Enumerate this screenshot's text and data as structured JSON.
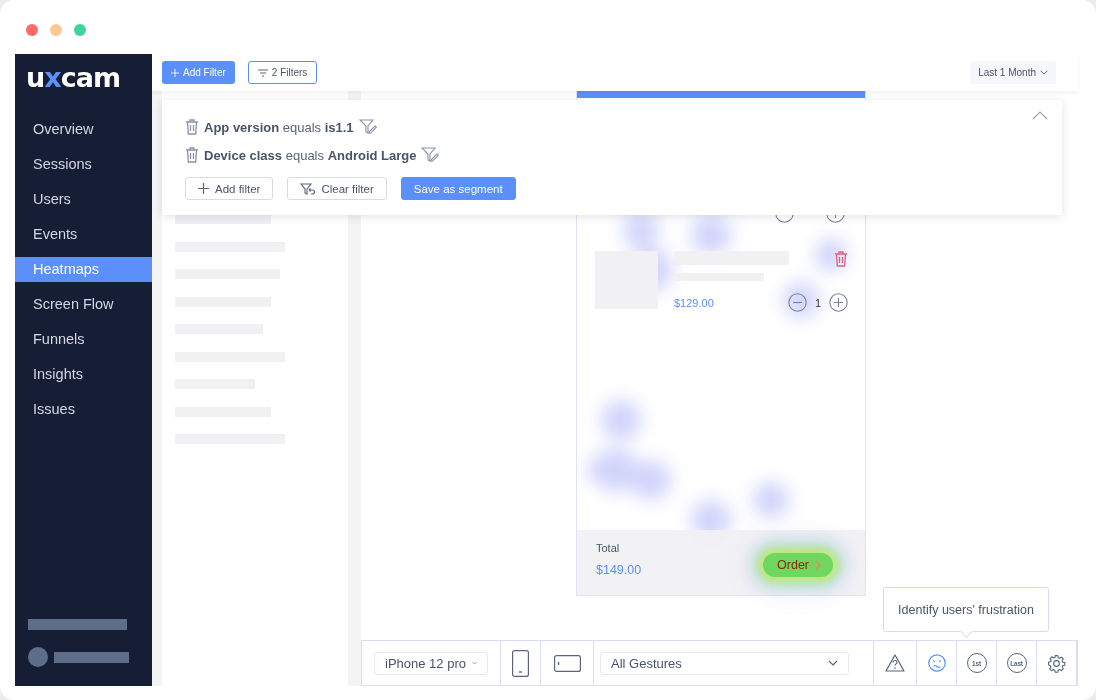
{
  "sidebar": {
    "logo": "uxcam",
    "items": [
      {
        "label": "Overview",
        "selected": false
      },
      {
        "label": "Sessions",
        "selected": false
      },
      {
        "label": "Users",
        "selected": false
      },
      {
        "label": "Events",
        "selected": false
      },
      {
        "label": "Heatmaps",
        "selected": true
      },
      {
        "label": "Screen Flow",
        "selected": false
      },
      {
        "label": "Funnels",
        "selected": false
      },
      {
        "label": "Insights",
        "selected": false
      },
      {
        "label": "Issues",
        "selected": false
      }
    ]
  },
  "topbar": {
    "add_filter": "Add Filter",
    "filters": "2 Filters",
    "date_range": "Last 1 Month"
  },
  "filter_panel": {
    "conditions": [
      "**App version** equals **is1.1**",
      "**Device class** equals **Android Large**"
    ],
    "actions": [
      {
        "kind": "add",
        "label": "Add filter"
      },
      {
        "kind": "clear",
        "label": "Clear filter"
      },
      {
        "kind": "save",
        "label": "Save as segment"
      }
    ]
  },
  "preview": {
    "items": [
      {
        "price": "$129.00",
        "quantity": "1"
      }
    ],
    "total_label": "Total",
    "total": "$149.00",
    "order_button": "Order"
  },
  "bottom_toolbar": {
    "device": "iPhone 12 pro",
    "orientations": [
      {
        "kind": "portrait"
      },
      {
        "kind": "landscape"
      }
    ],
    "gestures": "All Gestures",
    "tools": [
      {
        "kind": "warning",
        "selected": false
      },
      {
        "kind": "frustration",
        "selected": true
      },
      {
        "kind": "first",
        "label": "1st",
        "selected": false
      },
      {
        "kind": "last",
        "label": "Last",
        "selected": false
      },
      {
        "kind": "settings",
        "selected": false
      }
    ],
    "tooltip": "Identify users' frustration"
  }
}
